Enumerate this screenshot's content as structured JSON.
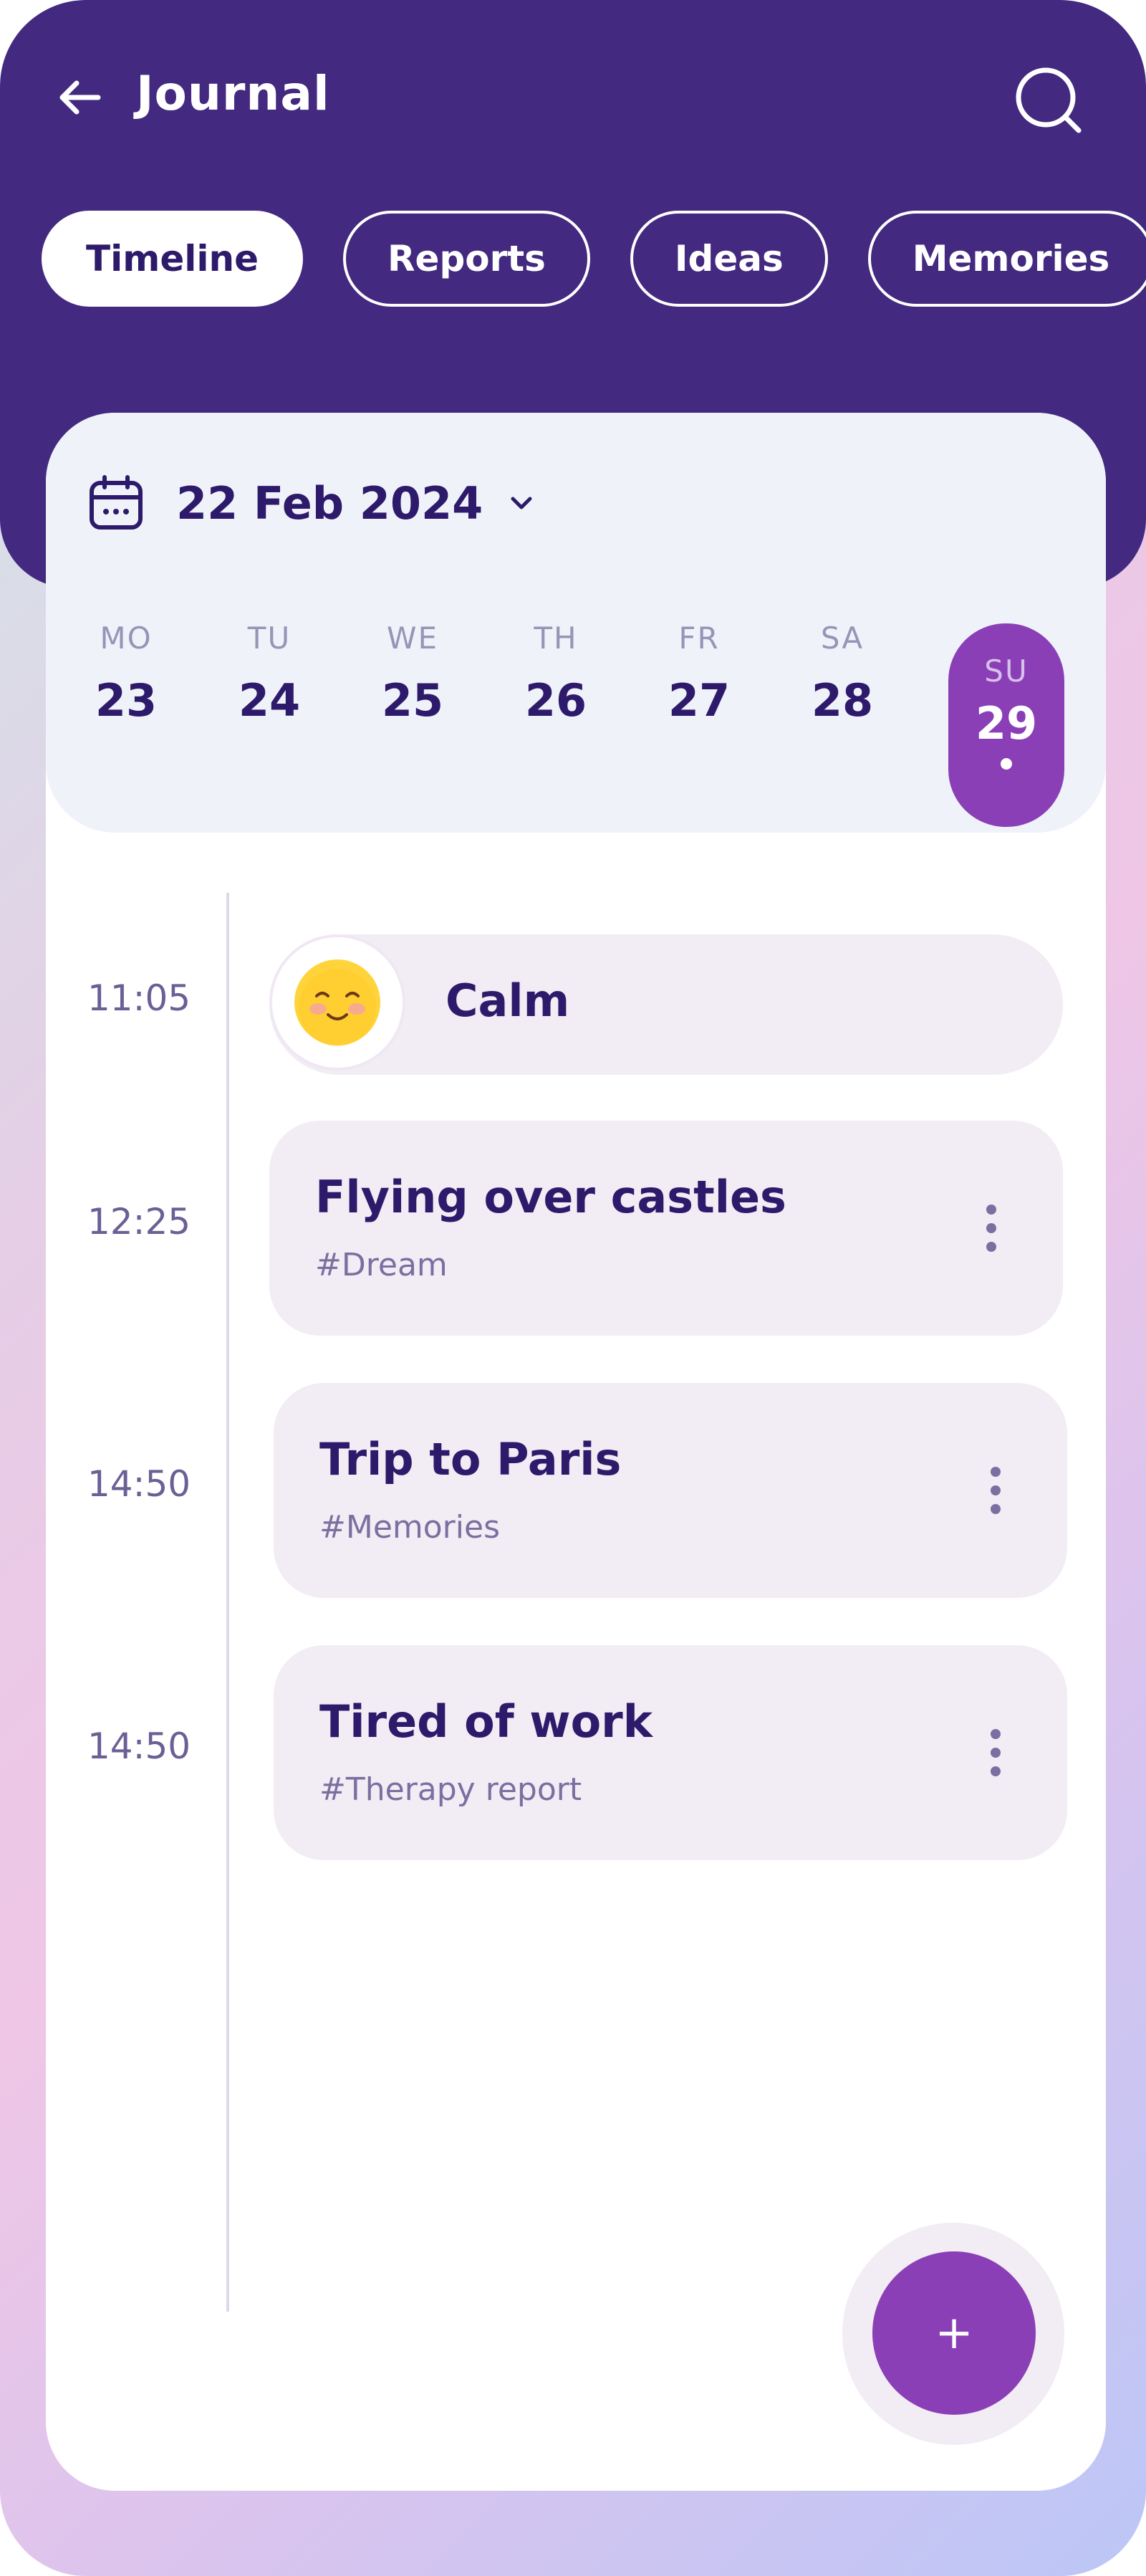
{
  "header": {
    "title": "Journal",
    "back_icon": "arrow-left-icon",
    "search_icon": "search-icon"
  },
  "tabs": [
    {
      "label": "Timeline",
      "active": true
    },
    {
      "label": "Reports",
      "active": false
    },
    {
      "label": "Ideas",
      "active": false
    },
    {
      "label": "Memories",
      "active": false
    }
  ],
  "date_picker": {
    "date": "22 Feb 2024",
    "icon": "calendar-icon",
    "dropdown_icon": "chevron-down-icon"
  },
  "week": [
    {
      "name": "MO",
      "num": "23"
    },
    {
      "name": "TU",
      "num": "24"
    },
    {
      "name": "WE",
      "num": "25"
    },
    {
      "name": "TH",
      "num": "26"
    },
    {
      "name": "FR",
      "num": "27"
    },
    {
      "name": "SA",
      "num": "28"
    },
    {
      "name": "SU",
      "num": "29",
      "selected": true
    }
  ],
  "timeline": {
    "mood": {
      "time": "11:05",
      "label": "Calm",
      "icon": "smiling-face-icon"
    },
    "entries": [
      {
        "time": "12:25",
        "title": "Flying over castles",
        "tag": "#Dream"
      },
      {
        "time": "14:50",
        "title": "Trip to Paris",
        "tag": "#Memories"
      },
      {
        "time": "14:50",
        "title": "Tired of work",
        "tag": "#Therapy report"
      }
    ]
  },
  "fab": {
    "label": "+"
  },
  "colors": {
    "header_bg": "#43297f",
    "accent": "#8a3fb6",
    "text_dark": "#2e1a6b",
    "entry_bg": "#f2ecf4",
    "date_panel_bg": "#eff3f9"
  }
}
